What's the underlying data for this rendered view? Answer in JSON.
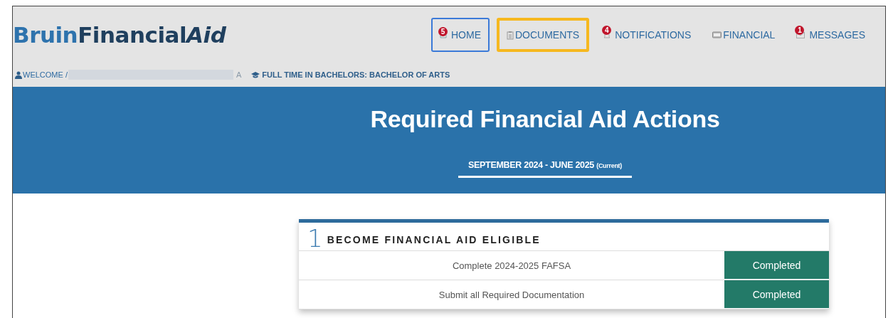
{
  "logo": {
    "accent": "Bruin",
    "main": "Financial",
    "italic": "Aid"
  },
  "nav": [
    {
      "label": "HOME",
      "kind": "home",
      "badge": "5",
      "focused": true,
      "outlined": false
    },
    {
      "label": "DOCUMENTS",
      "kind": "clipboard",
      "focused": false,
      "outlined": true
    },
    {
      "label": "NOTIFICATIONS",
      "kind": "bell",
      "badge": "4",
      "focused": false,
      "outlined": false
    },
    {
      "label": "FINANCIAL",
      "kind": "card",
      "focused": false,
      "outlined": false
    },
    {
      "label": "MESSAGES",
      "kind": "envelope",
      "badge": "1",
      "focused": false,
      "outlined": false
    }
  ],
  "user": {
    "welcome": "WELCOME /",
    "name_redacted": true,
    "tail": "A",
    "program": "FULL TIME IN BACHELORS: BACHELOR OF ARTS"
  },
  "banner": {
    "title": "Required Financial Aid Actions",
    "periods": [
      {
        "label": "SEPTEMBER 2024 - JUNE 2025",
        "note": "(Current)",
        "selected": true
      }
    ]
  },
  "steps": [
    {
      "number": "1",
      "title": "BECOME FINANCIAL AID ELIGIBLE",
      "tasks": [
        {
          "name": "Complete 2024-2025 FAFSA",
          "status": "Completed",
          "kind": "done"
        },
        {
          "name": "Submit all Required Documentation",
          "status": "Completed",
          "kind": "done"
        }
      ]
    }
  ]
}
